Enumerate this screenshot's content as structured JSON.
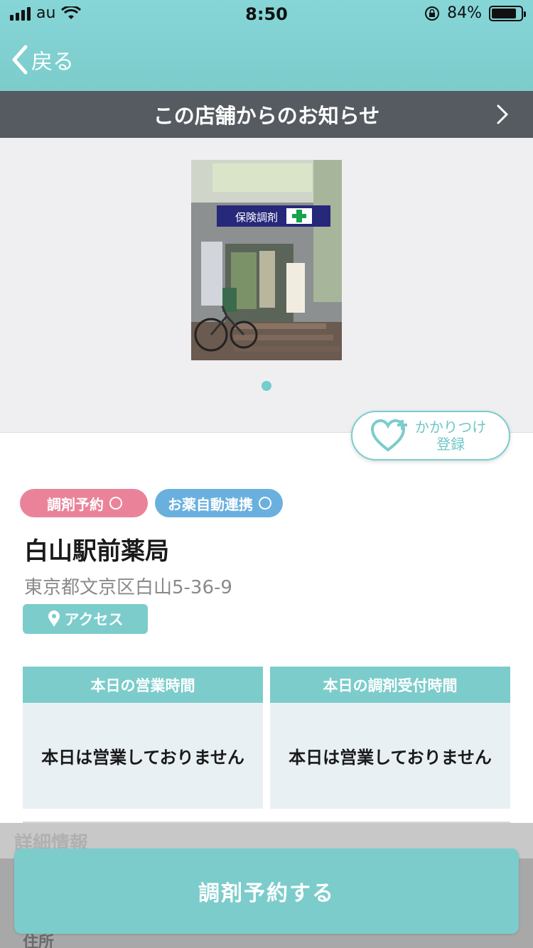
{
  "status_bar": {
    "carrier": "au",
    "time": "8:50",
    "battery_percent_label": "84%",
    "battery_level": 0.84
  },
  "nav": {
    "back_label": "戻る"
  },
  "notice": {
    "label": "この店舗からのお知らせ"
  },
  "gallery": {
    "photo_signage": "保険調剤",
    "pages": 1,
    "current_page": 1
  },
  "kakaritsuke": {
    "line1": "かかりつけ",
    "line2": "登録"
  },
  "tags": [
    {
      "label": "調剤予約",
      "color": "#ea8399"
    },
    {
      "label": "お薬自動連携",
      "color": "#6ab0df"
    }
  ],
  "store": {
    "name": "白山駅前薬局",
    "address": "東京都文京区白山5-36-9",
    "access_label": "アクセス"
  },
  "hours": {
    "business_title": "本日の営業時間",
    "business_value": "本日は営業しておりません",
    "dispensing_title": "本日の調剤受付時間",
    "dispensing_value": "本日は営業しておりません"
  },
  "details": {
    "section_title": "詳細情報",
    "peek_text": "住所"
  },
  "cta": {
    "label": "調剤予約する"
  },
  "colors": {
    "accent": "#7ccccc",
    "notice_bg": "#555b60",
    "tag_pink": "#ea8399",
    "tag_blue": "#6ab0df"
  }
}
